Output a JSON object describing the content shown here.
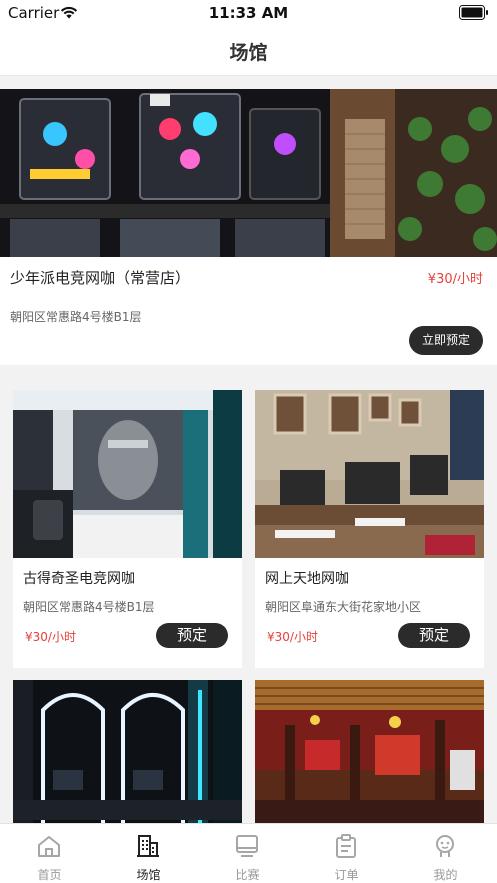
{
  "status_bar": {
    "carrier": "Carrier",
    "time": "11:33 AM"
  },
  "header": {
    "title": "场馆"
  },
  "featured": {
    "name": "少年派电竞网咖（常营店）",
    "price": "¥30/小时",
    "address": "朝阳区常惠路4号楼B1层",
    "book_label": "立即预定"
  },
  "venues": [
    {
      "name": "古得奇圣电竞网咖",
      "address": "朝阳区常惠路4号楼B1层",
      "price": "¥30/小时",
      "book_label": "预定"
    },
    {
      "name": "网上天地网咖",
      "address": "朝阳区阜通东大街花家地小区",
      "price": "¥30/小时",
      "book_label": "预定"
    },
    {
      "name": "",
      "address": "",
      "price": "",
      "book_label": ""
    },
    {
      "name": "",
      "address": "",
      "price": "",
      "book_label": ""
    }
  ],
  "tabs": [
    {
      "label": "首页",
      "icon": "home-icon"
    },
    {
      "label": "场馆",
      "icon": "building-icon",
      "active": true
    },
    {
      "label": "比赛",
      "icon": "monitor-icon"
    },
    {
      "label": "订单",
      "icon": "clipboard-icon"
    },
    {
      "label": "我的",
      "icon": "person-icon"
    }
  ],
  "colors": {
    "price": "#e5403a",
    "button": "#2b2b2b",
    "background": "#f2f2f2"
  }
}
